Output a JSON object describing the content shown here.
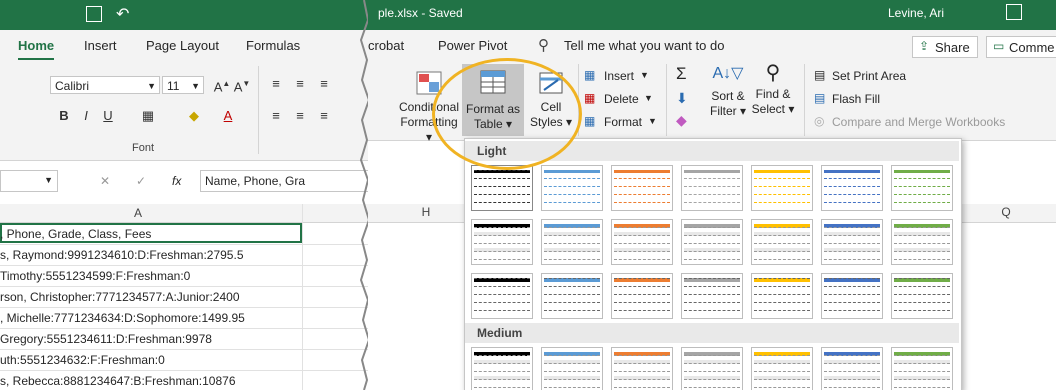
{
  "left": {
    "title_bits": "",
    "tabs": {
      "home": "Home",
      "insert": "Insert",
      "page_layout": "Page Layout",
      "formulas": "Formulas"
    },
    "font": {
      "name": "Calibri",
      "size": "11",
      "group_label": "Font",
      "bold": "B",
      "italic": "I",
      "underline": "U",
      "color_a": "A"
    },
    "formula_bar": {
      "fx": "fx",
      "cancel": "✕",
      "enter": "✓",
      "value": "Name, Phone, Gra"
    },
    "column_a": "A",
    "rows": [
      ", Phone, Grade, Class, Fees",
      "s, Raymond:9991234610:D:Freshman:2795.5",
      " Timothy:5551234599:F:Freshman:0",
      "rson, Christopher:7771234577:A:Junior:2400",
      ", Michelle:7771234634:D:Sophomore:1499.95",
      " Gregory:5551234611:D:Freshman:9978",
      "uth:5551234632:F:Freshman:0",
      "s, Rebecca:8881234647:B:Freshman:10876"
    ]
  },
  "right": {
    "title": "ple.xlsx  -  Saved",
    "user": "Levine, Ari",
    "tabs": {
      "acrobat": "crobat",
      "power_pivot": "Power Pivot",
      "tell_me": "Tell me what you want to do",
      "share": "Share",
      "comments": "Comme"
    },
    "conditional": [
      "Conditional",
      "Formatting ▾"
    ],
    "format_table": [
      "Format as",
      "Table ▾"
    ],
    "cell_styles": [
      "Cell",
      "Styles ▾"
    ],
    "insert": "Insert",
    "delete": "Delete",
    "format": "Format",
    "sort": [
      "Sort &",
      "Filter ▾"
    ],
    "find": [
      "Find &",
      "Select ▾"
    ],
    "set_print_area": "Set Print Area",
    "flash_fill": "Flash Fill",
    "compare_merge": "Compare and Merge Workbooks",
    "col_h": "H",
    "col_q": "Q",
    "gallery": {
      "light": "Light",
      "medium": "Medium"
    }
  },
  "colors": {
    "accent": "#217346",
    "highlight": "#f0b323"
  }
}
